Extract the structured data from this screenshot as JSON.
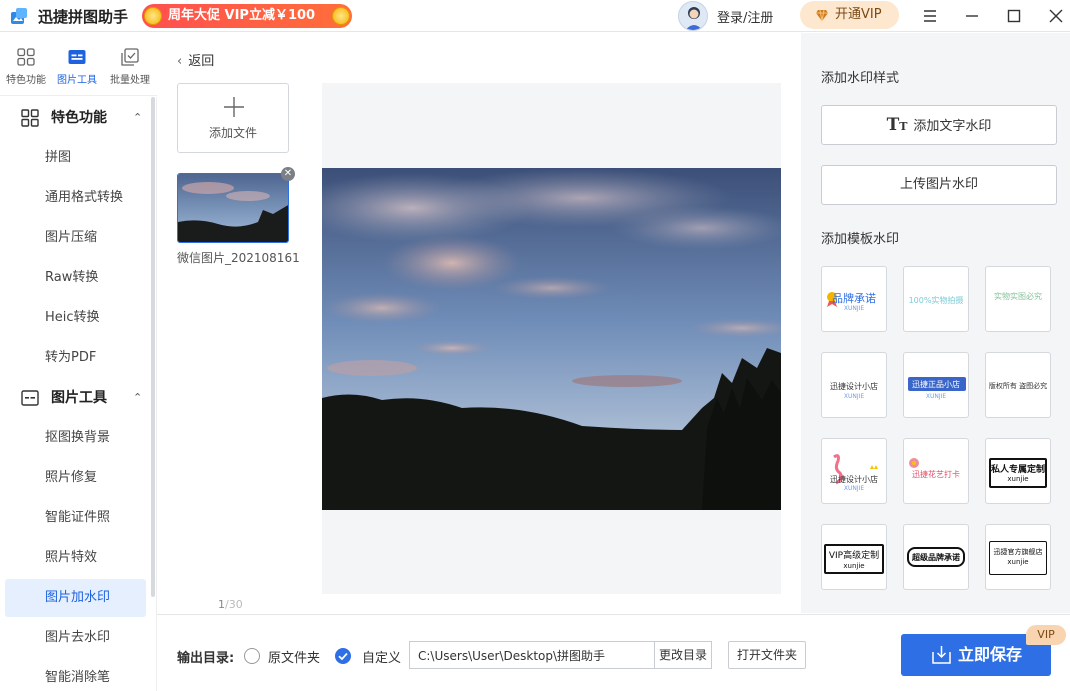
{
  "app": {
    "title": "迅捷拼图助手",
    "promo": "周年大促 VIP立减￥100",
    "login": "登录/注册",
    "vip_button": "开通VIP"
  },
  "left_tabs": [
    {
      "label": "特色功能",
      "icon": "grid-icon"
    },
    {
      "label": "图片工具",
      "icon": "image-tool-icon",
      "active": true
    },
    {
      "label": "批量处理",
      "icon": "batch-icon"
    }
  ],
  "sidebar": {
    "sections": [
      {
        "title": "特色功能",
        "items": [
          "拼图",
          "通用格式转换",
          "图片压缩",
          "Raw转换",
          "Heic转换",
          "转为PDF"
        ]
      },
      {
        "title": "图片工具",
        "items": [
          "抠图换背景",
          "照片修复",
          "智能证件照",
          "照片特效",
          "图片加水印",
          "图片去水印",
          "智能消除笔"
        ]
      }
    ],
    "active_item": "图片加水印"
  },
  "center": {
    "back": "返回",
    "add_file": "添加文件",
    "thumb_name": "微信图片_202108161...",
    "page_current": "1",
    "page_total": "/30"
  },
  "right": {
    "style_title": "添加水印样式",
    "add_text_btn": "添加文字水印",
    "upload_img_btn": "上传图片水印",
    "template_title": "添加模板水印",
    "templates": [
      {
        "text": "品牌承诺",
        "sub": "XUNJIE",
        "color": "#2f6fe5"
      },
      {
        "text": "100%实物拍摄",
        "sub": "",
        "color": "#7ccbd8"
      },
      {
        "text": "实物实图必究",
        "sub": "",
        "color": "#86c29a"
      },
      {
        "text": "迅捷设计小店",
        "sub": "XUNJIE",
        "color": "#333333"
      },
      {
        "text": "迅捷正品小店",
        "sub": "XUNJIE",
        "color": "#ffffff"
      },
      {
        "text": "版权所有 盗图必究",
        "sub": "",
        "color": "#333333"
      },
      {
        "text": "迅捷设计小店",
        "sub": "XUNJIE",
        "color": "#333333"
      },
      {
        "text": "迅捷花艺打卡",
        "sub": "",
        "color": "#e0506a"
      },
      {
        "text": "私人专属定制",
        "sub": "xunjie",
        "color": "#111111"
      },
      {
        "text": "VIP高级定制",
        "sub": "xunjie",
        "color": "#111111"
      },
      {
        "text": "超级品牌承诺",
        "sub": "",
        "color": "#111111"
      },
      {
        "text": "迅捷官方旗舰店",
        "sub": "xunjie",
        "color": "#111111"
      }
    ]
  },
  "bottom": {
    "output_label": "输出目录:",
    "radio_original": "原文件夹",
    "radio_custom": "自定义",
    "path": "C:\\Users\\User\\Desktop\\拼图助手",
    "change_dir": "更改目录",
    "open_folder": "打开文件夹",
    "save": "立即保存",
    "vip_tag": "VIP"
  },
  "colors": {
    "accent": "#2f6fe5",
    "promo": "#ff5a45",
    "vip_bg": "#fde8cf"
  }
}
